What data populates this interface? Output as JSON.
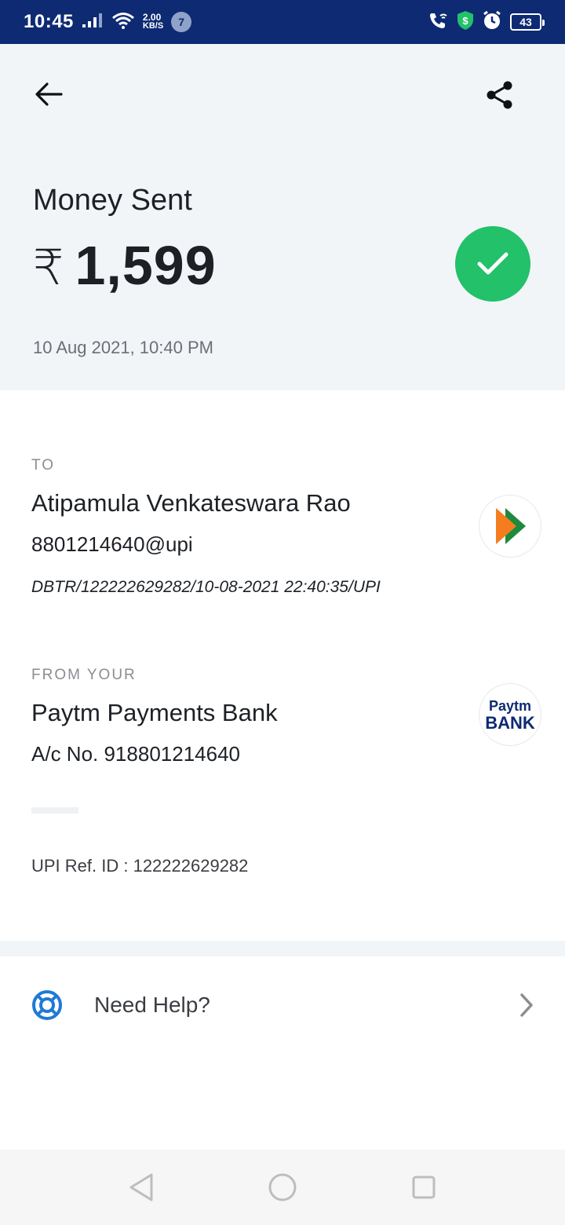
{
  "status_bar": {
    "time": "10:45",
    "net_speed_value": "2.00",
    "net_speed_unit": "KB/S",
    "notification_count": "7",
    "battery": "43"
  },
  "header": {
    "title": "Money Sent",
    "currency_symbol": "₹",
    "amount": "1,599",
    "datetime": "10 Aug 2021, 10:40 PM",
    "success_color": "#22c16a"
  },
  "to": {
    "label": "TO",
    "name": "Atipamula Venkateswara Rao",
    "upi_id": "8801214640@upi",
    "reference": "DBTR/122222629282/10-08-2021 22:40:35/UPI",
    "logo": "bhim-upi-logo"
  },
  "from": {
    "label": "FROM YOUR",
    "bank": "Paytm Payments Bank",
    "account": "A/c No. 918801214640",
    "logo_text_top": "Paytm",
    "logo_text_bottom": "BANK"
  },
  "upi_ref": "UPI Ref. ID : 122222629282",
  "help": {
    "label": "Need Help?"
  },
  "nav": {
    "back": "back-icon",
    "home": "home-icon",
    "recents": "recents-icon"
  }
}
